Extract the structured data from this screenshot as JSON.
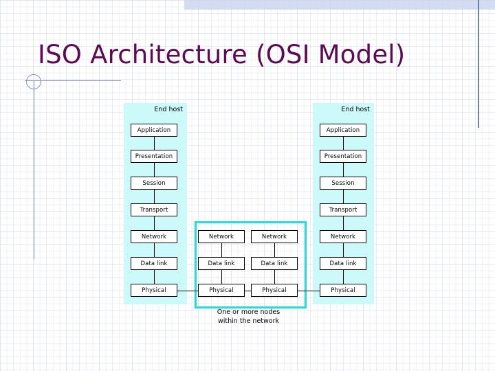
{
  "slide": {
    "title": "ISO Architecture (OSI Model)",
    "title_color": "#5C0A52",
    "band_color": "#CCFAFA",
    "node_border_color": "#25DCDC",
    "background": "#FFFFFF"
  },
  "diagram": {
    "end_host_label_left": "End host",
    "end_host_label_right": "End host",
    "caption_line1": "One or more nodes",
    "caption_line2": "within the network",
    "end_host_layers": [
      "Application",
      "Presentation",
      "Session",
      "Transport",
      "Network",
      "Data link",
      "Physical"
    ],
    "node_layers": [
      "Network",
      "Data link",
      "Physical"
    ],
    "columns": [
      {
        "kind": "end-host",
        "layers_key": "end_host_layers"
      },
      {
        "kind": "node",
        "layers_key": "node_layers"
      },
      {
        "kind": "node",
        "layers_key": "node_layers"
      },
      {
        "kind": "end-host",
        "layers_key": "end_host_layers"
      }
    ]
  }
}
